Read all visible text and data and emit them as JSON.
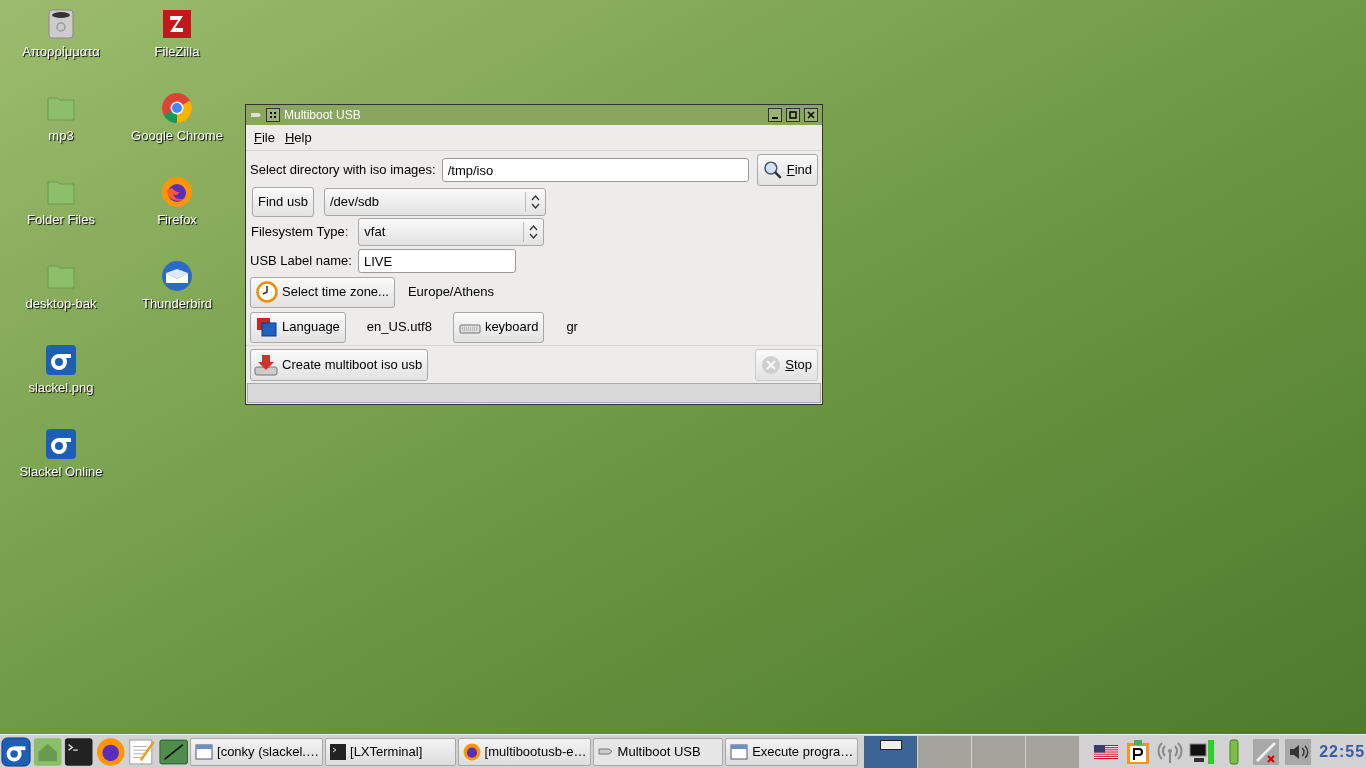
{
  "desktop_icons": [
    {
      "label": "Απορρίμματα",
      "kind": "trash"
    },
    {
      "label": "mp3",
      "kind": "folder"
    },
    {
      "label": "Folder Files",
      "kind": "folder"
    },
    {
      "label": "desktop-bak",
      "kind": "folder"
    },
    {
      "label": "slackel.png",
      "kind": "slackel"
    },
    {
      "label": "Slackel Online",
      "kind": "slackel"
    },
    {
      "label": "FileZilla",
      "kind": "filezilla"
    },
    {
      "label": "Google Chrome",
      "kind": "chrome"
    },
    {
      "label": "Firefox",
      "kind": "firefox"
    },
    {
      "label": "Thunderbird",
      "kind": "thunderbird"
    }
  ],
  "window": {
    "title": "Multiboot USB",
    "menu": [
      "File",
      "Help"
    ],
    "iso_dir": {
      "label": "Select directory with iso images:",
      "value": "/tmp/iso",
      "button": "Find"
    },
    "usb": {
      "button": "Find usb",
      "device": "/dev/sdb"
    },
    "filesystem": {
      "label": "Filesystem Type:",
      "value": "vfat"
    },
    "usb_label": {
      "label": "USB Label name:",
      "value": "LIVE"
    },
    "timezone": {
      "button": "Select time zone...",
      "value": "Europe/Athens"
    },
    "language": {
      "button": "Language",
      "value": "en_US.utf8"
    },
    "keyboard": {
      "button": "keyboard",
      "value": "gr"
    },
    "create_button": "Create multiboot iso usb",
    "stop_button": {
      "label": "Stop",
      "disabled": true
    }
  },
  "taskbar": {
    "launchers": [
      {
        "kind": "slackel"
      },
      {
        "kind": "home"
      },
      {
        "kind": "terminal"
      },
      {
        "kind": "firefox"
      },
      {
        "kind": "editor"
      },
      {
        "kind": "monitor"
      }
    ],
    "tasks": [
      {
        "label": "[conky (slackel.…",
        "kind": "window",
        "selected": false
      },
      {
        "label": "[LXTerminal]",
        "kind": "terminal",
        "selected": false
      },
      {
        "label": "[multibootusb-e…",
        "kind": "firefox",
        "selected": false
      },
      {
        "label": "Multiboot USB",
        "kind": "usb",
        "selected": true
      },
      {
        "label": "Execute progra…",
        "kind": "window",
        "selected": false
      }
    ],
    "desktops": [
      {
        "selected": true
      },
      {
        "selected": false
      },
      {
        "selected": false
      },
      {
        "selected": false
      }
    ],
    "tray": [
      {
        "kind": "flag"
      },
      {
        "kind": "clipboard"
      },
      {
        "kind": "wireless"
      },
      {
        "kind": "network"
      },
      {
        "kind": "battery"
      },
      {
        "kind": "disconnected"
      },
      {
        "kind": "volume"
      }
    ],
    "clock": "22:55"
  }
}
